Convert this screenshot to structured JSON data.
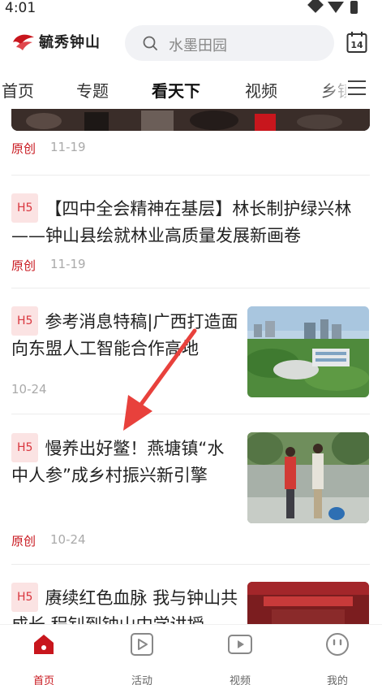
{
  "status_bar": {
    "time": "4:01"
  },
  "header": {
    "logo_text": "毓秀钟山",
    "search_placeholder": "水墨田园",
    "calendar_day": "14"
  },
  "nav": {
    "tabs": [
      {
        "label": "首页",
        "active": false
      },
      {
        "label": "专题",
        "active": false
      },
      {
        "label": "看天下",
        "active": true
      },
      {
        "label": "视频",
        "active": false
      },
      {
        "label": "乡镇",
        "active": false
      }
    ]
  },
  "feed": {
    "items": [
      {
        "badge": "",
        "title": "",
        "source": "原创",
        "date": "11-19"
      },
      {
        "badge": "H5",
        "title": "【四中全会精神在基层】林长制护绿兴林——钟山县绘就林业高质量发展新画卷",
        "source": "原创",
        "date": "11-19"
      },
      {
        "badge": "H5",
        "title": "参考消息特稿|广西打造面向东盟人工智能合作高地",
        "source": "",
        "date": "10-24"
      },
      {
        "badge": "H5",
        "title": "慢养出好鳖！燕塘镇“水中人参”成乡村振兴新引擎",
        "source": "原创",
        "date": "10-24"
      },
      {
        "badge": "H5",
        "title": "赓续红色血脉 我与钟山共成长 程钊到钟山中学讲授",
        "source": "",
        "date": ""
      }
    ]
  },
  "bottom_nav": {
    "items": [
      {
        "label": "首页",
        "active": true
      },
      {
        "label": "活动",
        "active": false
      },
      {
        "label": "视频",
        "active": false
      },
      {
        "label": "我的",
        "active": false
      }
    ]
  },
  "colors": {
    "brand": "#c8161d",
    "badge_bg": "#fbe3e3",
    "badge_text": "#d9363e",
    "arrow": "#e8413c"
  }
}
